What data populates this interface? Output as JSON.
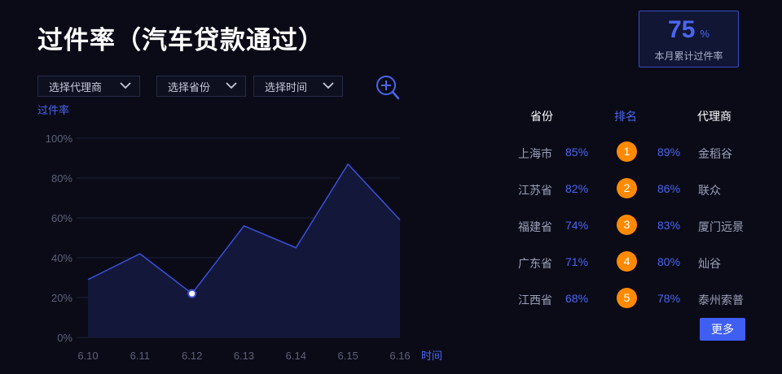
{
  "title": "过件率（汽车贷款通过）",
  "kpi": {
    "value": "75",
    "unit": "%",
    "label": "本月累计过件率"
  },
  "filters": [
    {
      "label": "选择代理商"
    },
    {
      "label": "选择省份"
    },
    {
      "label": "选择时间"
    }
  ],
  "chart_data": {
    "type": "area",
    "ylabel": "过件率",
    "xlabel": "时间",
    "categories": [
      "6.10",
      "6.11",
      "6.12",
      "6.13",
      "6.14",
      "6.15",
      "6.16"
    ],
    "values": [
      29,
      42,
      22,
      56,
      45,
      87,
      59
    ],
    "highlight_index": 2,
    "ylim": [
      0,
      100
    ],
    "yticks": [
      "0%",
      "20%",
      "40%",
      "60%",
      "80%",
      "100%"
    ],
    "grid": true,
    "colors": {
      "line": "#3b50d6",
      "fill": "#13173a",
      "grid": "#1e2236",
      "tick": "#5c6178",
      "label": "#4a66f0"
    }
  },
  "table": {
    "headers": {
      "province": "省份",
      "rank": "排名",
      "agent": "代理商"
    },
    "rows": [
      {
        "province": "上海市",
        "province_rate": "85%",
        "rank": "1",
        "agent_rate": "89%",
        "agent": "金稻谷"
      },
      {
        "province": "江苏省",
        "province_rate": "82%",
        "rank": "2",
        "agent_rate": "86%",
        "agent": "联众"
      },
      {
        "province": "福建省",
        "province_rate": "74%",
        "rank": "3",
        "agent_rate": "83%",
        "agent": "厦门远景"
      },
      {
        "province": "广东省",
        "province_rate": "71%",
        "rank": "4",
        "agent_rate": "80%",
        "agent": "灿谷"
      },
      {
        "province": "江西省",
        "province_rate": "68%",
        "rank": "5",
        "agent_rate": "78%",
        "agent": "泰州索普"
      }
    ],
    "more_label": "更多"
  },
  "colors": {
    "accent": "#4a66f0",
    "rank_badge": "#ff8a00",
    "background": "#0b0b18"
  },
  "icons": {
    "zoom": "zoom-in-icon",
    "dropdown": "chevron-down-icon"
  }
}
